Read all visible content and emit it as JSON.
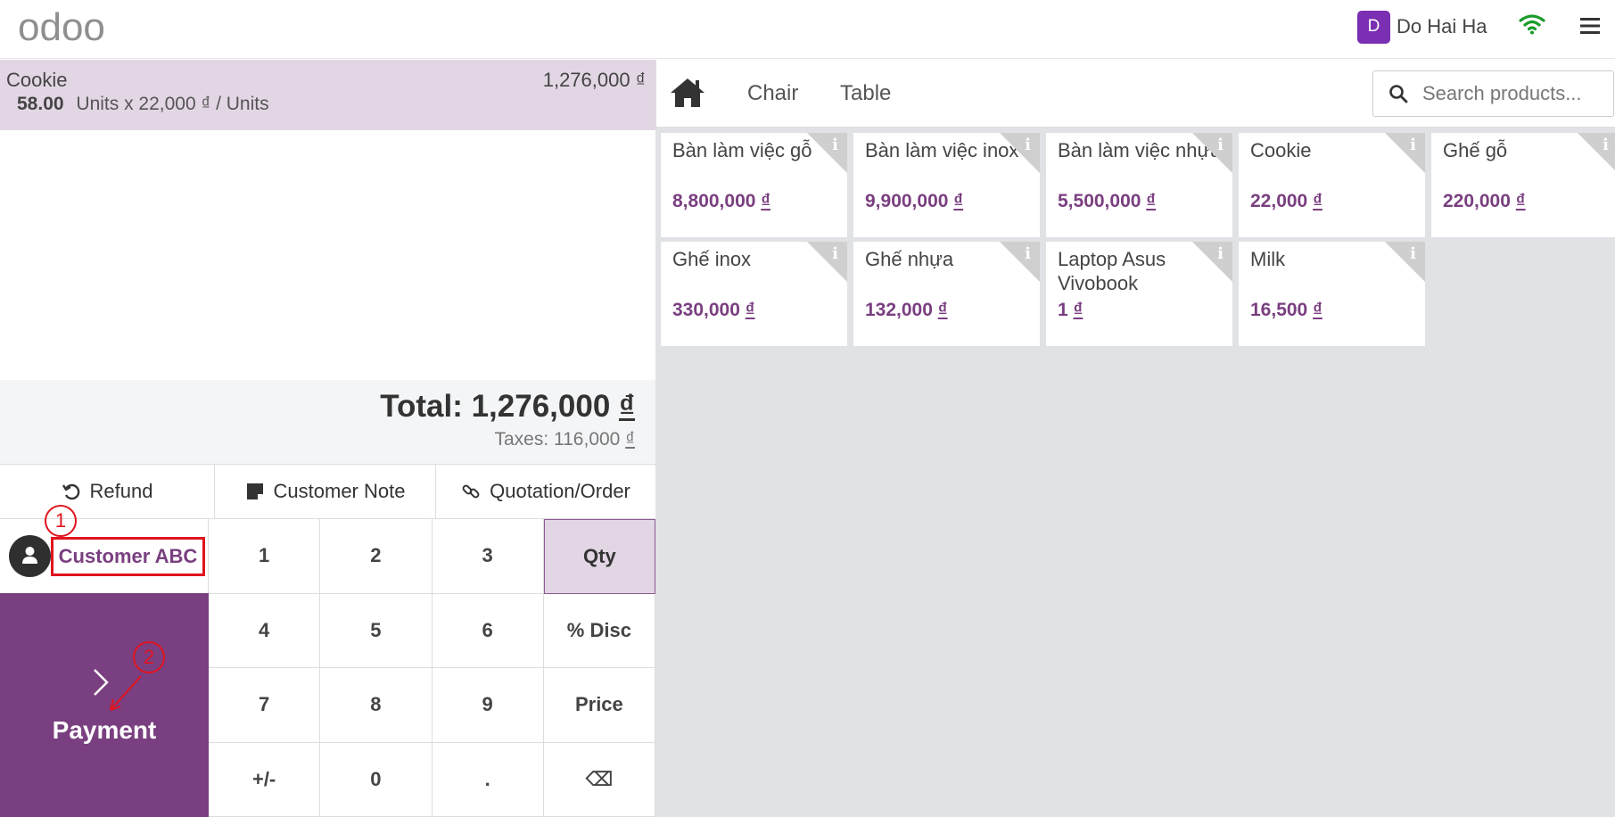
{
  "header": {
    "logo_text": "odoo",
    "user_initial": "D",
    "user_name": "Do Hai Ha"
  },
  "order": {
    "line": {
      "product": "Cookie",
      "price": "1,276,000 ₫",
      "qty": "58.00",
      "detail": "Units x 22,000 ₫ / Units"
    },
    "total_label": "Total: 1,276,000",
    "total_currency": "₫",
    "taxes_label": "Taxes: 116,000",
    "taxes_currency": "₫"
  },
  "controls": {
    "refund": "Refund",
    "customer_note": "Customer Note",
    "quotation": "Quotation/Order"
  },
  "customer": {
    "name": "Customer ABC"
  },
  "payment": {
    "label": "Payment"
  },
  "numpad": {
    "keys": [
      "1",
      "2",
      "3",
      "Qty",
      "4",
      "5",
      "6",
      "% Disc",
      "7",
      "8",
      "9",
      "Price",
      "+/-",
      "0",
      ".",
      "⌫"
    ]
  },
  "annotations": {
    "step1": "1",
    "step2": "2"
  },
  "categories": {
    "items": [
      "Chair",
      "Table"
    ]
  },
  "search": {
    "placeholder": "Search products..."
  },
  "products": [
    {
      "name": "Bàn làm việc gỗ",
      "price": "8,800,000",
      "currency": "₫"
    },
    {
      "name": "Bàn làm việc inox",
      "price": "9,900,000",
      "currency": "₫"
    },
    {
      "name": "Bàn làm việc nhựa",
      "price": "5,500,000",
      "currency": "₫"
    },
    {
      "name": "Cookie",
      "price": "22,000",
      "currency": "₫"
    },
    {
      "name": "Ghế gỗ",
      "price": "220,000",
      "currency": "₫"
    },
    {
      "name": "Ghế inox",
      "price": "330,000",
      "currency": "₫"
    },
    {
      "name": "Ghế nhựa",
      "price": "132,000",
      "currency": "₫"
    },
    {
      "name": "Laptop Asus Vivobook",
      "price": "1",
      "currency": "₫"
    },
    {
      "name": "Milk",
      "price": "16,500",
      "currency": "₫"
    }
  ],
  "colors": {
    "brand": "#7a3f80",
    "selected_line": "#e2d6e4",
    "annotation": "#e0141e",
    "wifi": "#1a9a2a"
  }
}
